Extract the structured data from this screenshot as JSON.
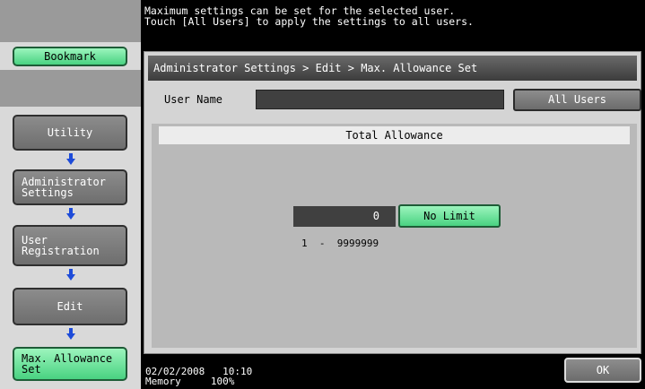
{
  "message": {
    "line1": "Maximum settings can be set for the selected user.",
    "line2": "Touch [All Users] to apply the settings to all users."
  },
  "sidebar": {
    "bookmark_label": "Bookmark",
    "utility_label": "Utility",
    "admin_label_1": "Administrator",
    "admin_label_2": "Settings",
    "user_reg_label_1": "User",
    "user_reg_label_2": "Registration",
    "edit_label": "Edit",
    "max_allow_label_1": "Max. Allowance",
    "max_allow_label_2": "Set",
    "arrow_icon": "arrow-down-icon"
  },
  "main": {
    "breadcrumb": "Administrator Settings > Edit > Max. Allowance Set",
    "user_name_label": "User Name",
    "user_name_value": "",
    "all_users_label": "All Users",
    "total_allowance_title": "Total Allowance",
    "allowance_value": "0",
    "no_limit_label": "No Limit",
    "range_text": "1  -  9999999"
  },
  "footer": {
    "date": "02/02/2008",
    "time": "10:10",
    "memory_label": "Memory",
    "memory_value": "100%",
    "ok_label": "OK"
  },
  "colors": {
    "accent_green": "#49d281",
    "button_gray": "#7a7a7a",
    "background": "#000000"
  }
}
